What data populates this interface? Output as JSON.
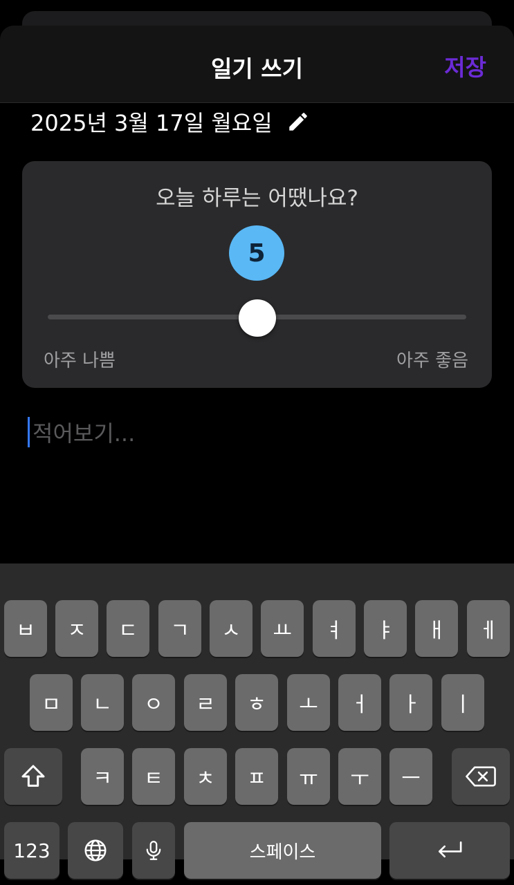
{
  "header": {
    "title": "일기 쓰기",
    "save_label": "저장"
  },
  "date": {
    "text": "2025년 3월 17일 월요일"
  },
  "mood": {
    "question": "오늘 하루는 어땠나요?",
    "value": "5",
    "min": 0,
    "max": 10,
    "current": 5,
    "min_label": "아주 나쁨",
    "max_label": "아주 좋음",
    "badge_color": "#5ab8f5"
  },
  "note": {
    "placeholder": "적어보기..."
  },
  "colors": {
    "accent": "#6b2bd6",
    "caret": "#3478f6"
  },
  "keyboard": {
    "row1": [
      "ㅂ",
      "ㅈ",
      "ㄷ",
      "ㄱ",
      "ㅅ",
      "ㅛ",
      "ㅕ",
      "ㅑ",
      "ㅐ",
      "ㅔ"
    ],
    "row2": [
      "ㅁ",
      "ㄴ",
      "ㅇ",
      "ㄹ",
      "ㅎ",
      "ㅗ",
      "ㅓ",
      "ㅏ",
      "ㅣ"
    ],
    "row3": [
      "ㅋ",
      "ㅌ",
      "ㅊ",
      "ㅍ",
      "ㅠ",
      "ㅜ",
      "ㅡ"
    ],
    "numbers_label": "123",
    "space_label": "스페이스",
    "icons": {
      "shift": "shift-icon",
      "delete": "delete-icon",
      "globe": "globe-icon",
      "mic": "mic-icon",
      "return": "return-icon"
    }
  }
}
